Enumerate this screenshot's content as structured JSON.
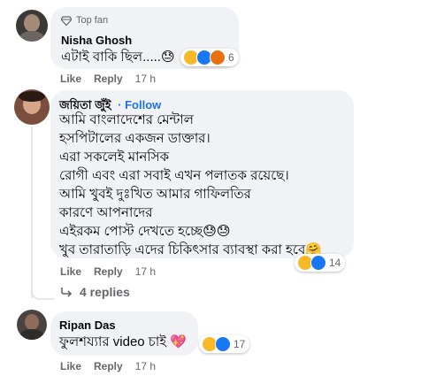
{
  "comments": [
    {
      "badge": "Top fan",
      "name": "Nisha Ghosh",
      "text": "এটাই বাকি ছিল.....😓",
      "like": "Like",
      "reply": "Reply",
      "time": "17 h",
      "react_count": "6"
    },
    {
      "name": "জয়িতা জুঁই",
      "follow": "· Follow",
      "lines": [
        "আমি বাংলাদেশের মেন্টাল",
        "হসপিটালের একজন ডাক্তার।",
        "এরা সকলেই মানসিক",
        "রোগী এবং এরা সবাই এখন পলাতক রয়েছে।",
        "আমি খুবই দুঃখিত আমার গাফিলতির",
        "কারণে আপনাদের",
        "এইরকম পোস্ট দেখতে হচ্ছে😓😓",
        "খুব তারাতাড়ি এদের চিকিৎসার ব্যাবস্থা করা হবে🤗"
      ],
      "like": "Like",
      "reply": "Reply",
      "time": "17 h",
      "react_count": "14",
      "replies_label": "4 replies"
    },
    {
      "name": "Ripan Das",
      "text": "ফুলশয্যার video চাই 💖",
      "like": "Like",
      "reply": "Reply",
      "time": "17 h",
      "react_count": "17"
    }
  ],
  "colors": {
    "haha": "#f7b928",
    "like": "#1877f2",
    "angry": "#e9710f",
    "link": "#1b74e4"
  }
}
